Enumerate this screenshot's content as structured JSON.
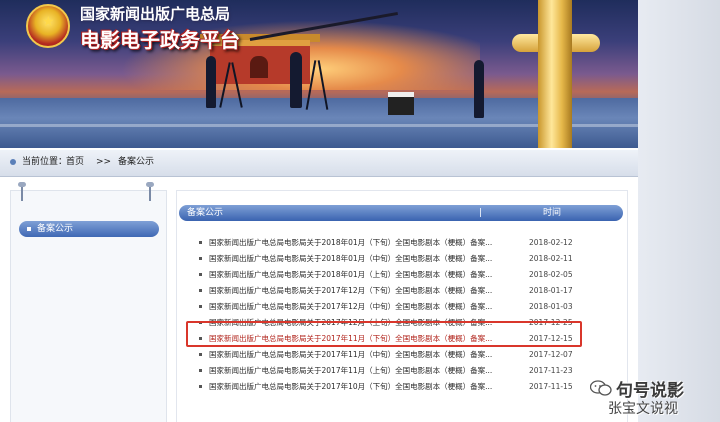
{
  "banner": {
    "org_name": "国家新闻出版广电总局",
    "platform_name": "电影电子政务平台"
  },
  "breadcrumb": {
    "label": "当前位置：",
    "home": "首页",
    "separator": ">>",
    "current": "备案公示"
  },
  "sidebar": {
    "items": [
      {
        "label": "备案公示"
      }
    ]
  },
  "main": {
    "title": "备案公示",
    "separator": "|",
    "time_header": "时间",
    "rows": [
      {
        "title": "国家新闻出版广电总局电影局关于2018年01月（下旬）全国电影剧本（梗概）备案...",
        "date": "2018-02-12"
      },
      {
        "title": "国家新闻出版广电总局电影局关于2018年01月（中旬）全国电影剧本（梗概）备案...",
        "date": "2018-02-11"
      },
      {
        "title": "国家新闻出版广电总局电影局关于2018年01月（上旬）全国电影剧本（梗概）备案...",
        "date": "2018-02-05"
      },
      {
        "title": "国家新闻出版广电总局电影局关于2017年12月（下旬）全国电影剧本（梗概）备案...",
        "date": "2018-01-17"
      },
      {
        "title": "国家新闻出版广电总局电影局关于2017年12月（中旬）全国电影剧本（梗概）备案...",
        "date": "2018-01-03"
      },
      {
        "title": "国家新闻出版广电总局电影局关于2017年12月（上旬）全国电影剧本（梗概）备案...",
        "date": "2017-12-25"
      },
      {
        "title": "国家新闻出版广电总局电影局关于2017年11月（下旬）全国电影剧本（梗概）备案...",
        "date": "2017-12-15"
      },
      {
        "title": "国家新闻出版广电总局电影局关于2017年11月（中旬）全国电影剧本（梗概）备案...",
        "date": "2017-12-07"
      },
      {
        "title": "国家新闻出版广电总局电影局关于2017年11月（上旬）全国电影剧本（梗概）备案...",
        "date": "2017-11-23"
      },
      {
        "title": "国家新闻出版广电总局电影局关于2017年10月（下旬）全国电影剧本（梗概）备案...",
        "date": "2017-11-15"
      }
    ],
    "highlighted_row": 6
  },
  "watermark": {
    "line1": "句号说影",
    "line2": "张宝文说视"
  },
  "colors": {
    "accent": "#3f68b4",
    "highlight_border": "#d9362b"
  }
}
